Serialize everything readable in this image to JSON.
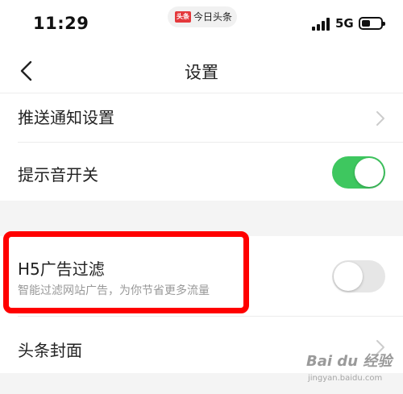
{
  "status_bar": {
    "time": "11:29",
    "app_name": "今日头条",
    "app_logo_text": "头条",
    "network": "5G"
  },
  "nav": {
    "title": "设置"
  },
  "settings": [
    {
      "label": "推送通知设置",
      "control": "chevron"
    },
    {
      "label": "提示音开关",
      "control": "toggle",
      "on": true
    },
    {
      "label": "H5广告过滤",
      "sublabel": "智能过滤网站广告，为你节省更多流量",
      "control": "toggle",
      "on": false
    },
    {
      "label": "头条封面",
      "control": "chevron"
    }
  ],
  "colors": {
    "toggle_on": "#3ec75f",
    "toggle_off": "#e6e6e6",
    "highlight": "#ff0000",
    "app_logo": "#e4393c"
  },
  "watermark": {
    "text": "Bai du 经验",
    "url": "jingyan.baidu.com"
  }
}
